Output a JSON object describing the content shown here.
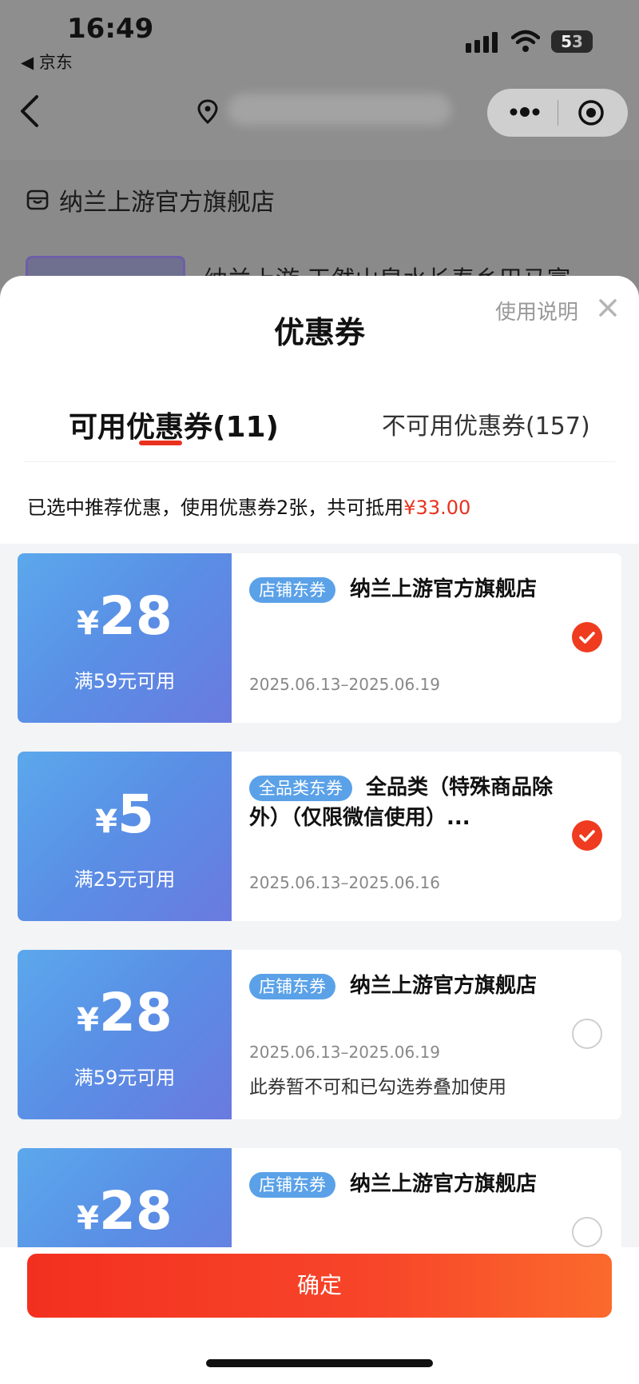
{
  "status_bar": {
    "time": "16:49",
    "back_app": "◀ 京东",
    "battery_on": "5",
    "battery_off": "3"
  },
  "background": {
    "store_name": "纳兰上游官方旗舰店",
    "product_title": "纳兰上游 天然山泉水长寿乡巴马富"
  },
  "sheet": {
    "title": "优惠券",
    "help_link": "使用说明",
    "tabs": {
      "available": "可用优惠券(11)",
      "unavailable": "不可用优惠券(157)"
    },
    "summary": "已选中推荐优惠，使用优惠券2张，共可抵用",
    "summary_amount": "¥33.00",
    "colors": {
      "accent": "#e8321f",
      "coupon_blue": "#5a8ee5",
      "badge_blue": "#5aa1e8"
    }
  },
  "coupons": [
    {
      "yen": "¥",
      "amount": "28",
      "condition": "满59元可用",
      "badge": "店铺东券",
      "name": "纳兰上游官方旗舰店",
      "name_line2": "",
      "date": "2025.06.13–2025.06.19",
      "note": "",
      "checked": true
    },
    {
      "yen": "¥",
      "amount": "5",
      "condition": "满25元可用",
      "badge": "全品类东券",
      "name": "全品类（特殊商品除",
      "name_line2": "外）（仅限微信使用）...",
      "date": "2025.06.13–2025.06.16",
      "note": "",
      "checked": true
    },
    {
      "yen": "¥",
      "amount": "28",
      "condition": "满59元可用",
      "badge": "店铺东券",
      "name": "纳兰上游官方旗舰店",
      "name_line2": "",
      "date": "2025.06.13–2025.06.19",
      "note": "此券暂不可和已勾选券叠加使用",
      "checked": false
    },
    {
      "yen": "¥",
      "amount": "28",
      "condition": "",
      "badge": "店铺东券",
      "name": "纳兰上游官方旗舰店",
      "name_line2": "",
      "date": "",
      "note": "",
      "checked": false
    }
  ],
  "footer": {
    "confirm": "确定"
  }
}
